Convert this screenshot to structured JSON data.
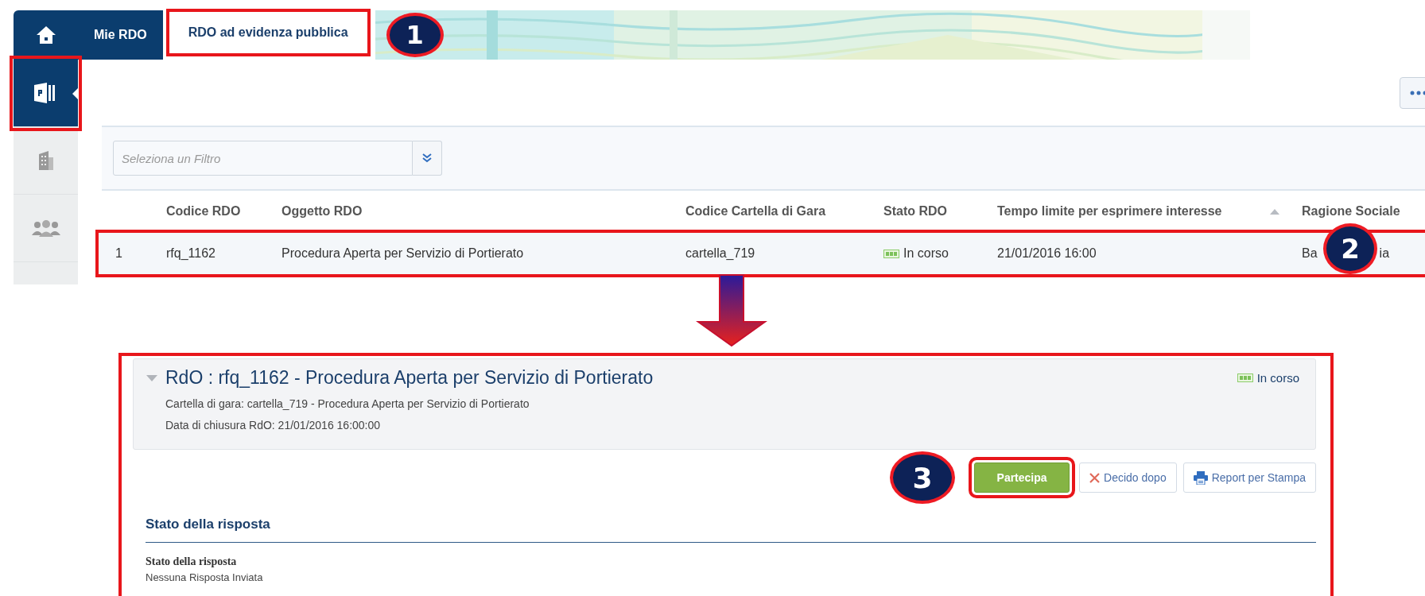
{
  "nav": {
    "tabs": [
      {
        "label": "Mie RDO",
        "selected": false
      },
      {
        "label": "RDO ad evidenza pubblica",
        "selected": true
      }
    ]
  },
  "sidebar": {
    "items": [
      {
        "kind": "document",
        "selected": true
      },
      {
        "kind": "building",
        "selected": false
      },
      {
        "kind": "people",
        "selected": false
      }
    ]
  },
  "filter": {
    "placeholder": "Seleziona un Filtro"
  },
  "table": {
    "columns": [
      {
        "label": "Codice RDO",
        "sorted": false
      },
      {
        "label": "Oggetto RDO",
        "sorted": false
      },
      {
        "label": "Codice Cartella di Gara",
        "sorted": false
      },
      {
        "label": "Stato RDO",
        "sorted": false
      },
      {
        "label": "Tempo limite per esprimere interesse",
        "sorted": true
      },
      {
        "label": "Ragione Sociale",
        "sorted": false
      }
    ],
    "rows": [
      {
        "number": "1",
        "codice": "rfq_1162",
        "oggetto": "Procedura Aperta per Servizio di Portierato",
        "cartella": "cartella_719",
        "stato": "In corso",
        "tempo": "21/01/2016 16:00",
        "ragione_sociale_parts": [
          "Ba",
          "ia"
        ]
      }
    ]
  },
  "detail": {
    "expanded": true,
    "title": "RdO : rfq_1162 - Procedura Aperta per Servizio di Portierato",
    "status": "In corso",
    "lines": [
      "Cartella di gara: cartella_719 - Procedura Aperta per Servizio di Portierato",
      "Data di chiusura RdO: 21/01/2016 16:00:00"
    ],
    "actions": [
      {
        "label": "Partecipa",
        "kind": "primary"
      },
      {
        "label": "Decido dopo",
        "kind": "dismiss"
      },
      {
        "label": "Report per Stampa",
        "kind": "print"
      }
    ],
    "section": {
      "heading": "Stato della risposta",
      "field_label": "Stato della risposta",
      "field_value": "Nessuna Risposta Inviata"
    }
  },
  "annotations": {
    "markers": [
      "1",
      "2",
      "3"
    ]
  }
}
